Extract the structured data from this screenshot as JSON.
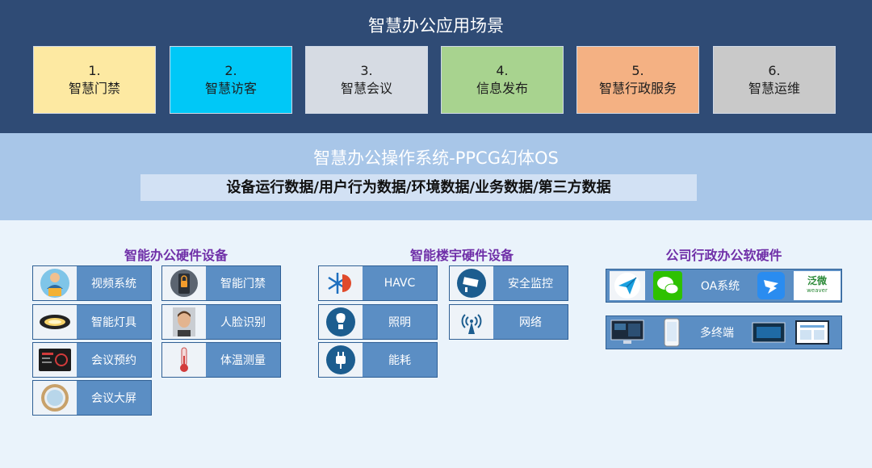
{
  "header": {
    "title": "智慧办公应用场景"
  },
  "scenes": [
    {
      "num": "1.",
      "label": "智慧门禁",
      "color": "#fde9a2"
    },
    {
      "num": "2.",
      "label": "智慧访客",
      "color": "#00c8f7"
    },
    {
      "num": "3.",
      "label": "智慧会议",
      "color": "#d6dbe3"
    },
    {
      "num": "4.",
      "label": "信息发布",
      "color": "#a8d38f"
    },
    {
      "num": "5.",
      "label": "智慧行政服务",
      "color": "#f4b183"
    },
    {
      "num": "6.",
      "label": "智慧运维",
      "color": "#c9c9c9"
    }
  ],
  "os": {
    "title": "智慧办公操作系统-PPCG幻体OS",
    "data_bar": "设备运行数据/用户行为数据/环境数据/业务数据/第三方数据"
  },
  "groups": {
    "office_hw": {
      "title": "智能办公硬件设备",
      "items": [
        "视频系统",
        "智能灯具",
        "会议预约",
        "会议大屏",
        "智能门禁",
        "人脸识别",
        "体温测量"
      ]
    },
    "building_hw": {
      "title": "智能楼宇硬件设备",
      "items": [
        "HAVC",
        "照明",
        "能耗",
        "安全监控",
        "网络"
      ]
    },
    "admin_sw": {
      "title": "公司行政办公软硬件",
      "oa_label": "OA系统",
      "terminal_label": "多终端",
      "fanwei_text": "泛微",
      "fanwei_sub": "weaver"
    }
  },
  "icons": [
    "video-presenter-icon",
    "ceiling-lamp-icon",
    "meeting-panel-icon",
    "round-screen-icon",
    "smart-lock-icon",
    "face-photo-icon",
    "thermometer-icon",
    "hvac-icon",
    "bulb-icon",
    "plug-icon",
    "camera-icon",
    "wifi-antenna-icon",
    "paper-plane-icon",
    "wechat-icon",
    "dingtalk-icon",
    "fanwei-logo",
    "monitor-icon",
    "phone-icon",
    "tablet-icon",
    "dashboard-icon"
  ]
}
